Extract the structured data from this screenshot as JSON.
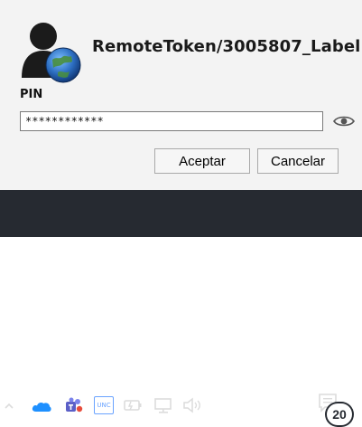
{
  "dialog": {
    "title": "RemoteToken/3005807_Label",
    "pin_label": "PIN",
    "pin_value": "************",
    "ok_label": "Aceptar",
    "cancel_label": "Cancelar",
    "icons": {
      "avatar": "user-globe-icon",
      "reveal": "eye-icon"
    }
  },
  "taskbar": {
    "tray_icons": [
      "chevron-up-icon",
      "onedrive-cloud-icon",
      "teams-icon",
      "unc-icon",
      "battery-icon",
      "network-icon",
      "speaker-icon",
      "notification-icon"
    ],
    "unc_text": "UNC",
    "notification_count": "20"
  }
}
